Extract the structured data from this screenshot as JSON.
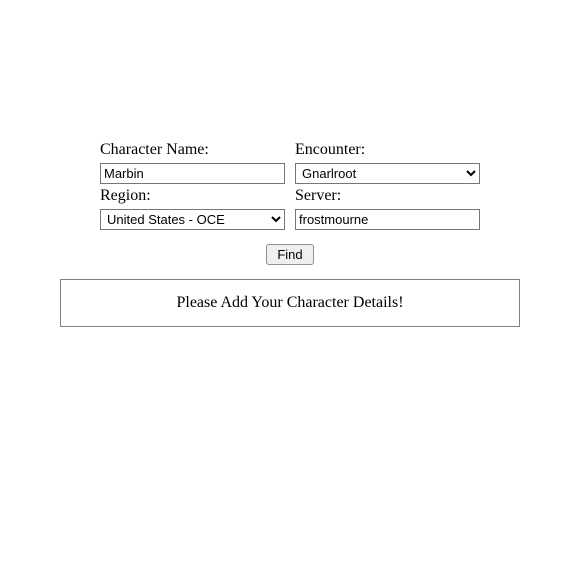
{
  "form": {
    "character_name": {
      "label": "Character Name:",
      "value": "Marbin"
    },
    "encounter": {
      "label": "Encounter:",
      "selected": "Gnarlroot"
    },
    "region": {
      "label": "Region:",
      "selected": "United States - OCE"
    },
    "server": {
      "label": "Server:",
      "value": "frostmourne"
    },
    "find_button": "Find"
  },
  "result": {
    "message": "Please Add Your Character Details!"
  }
}
